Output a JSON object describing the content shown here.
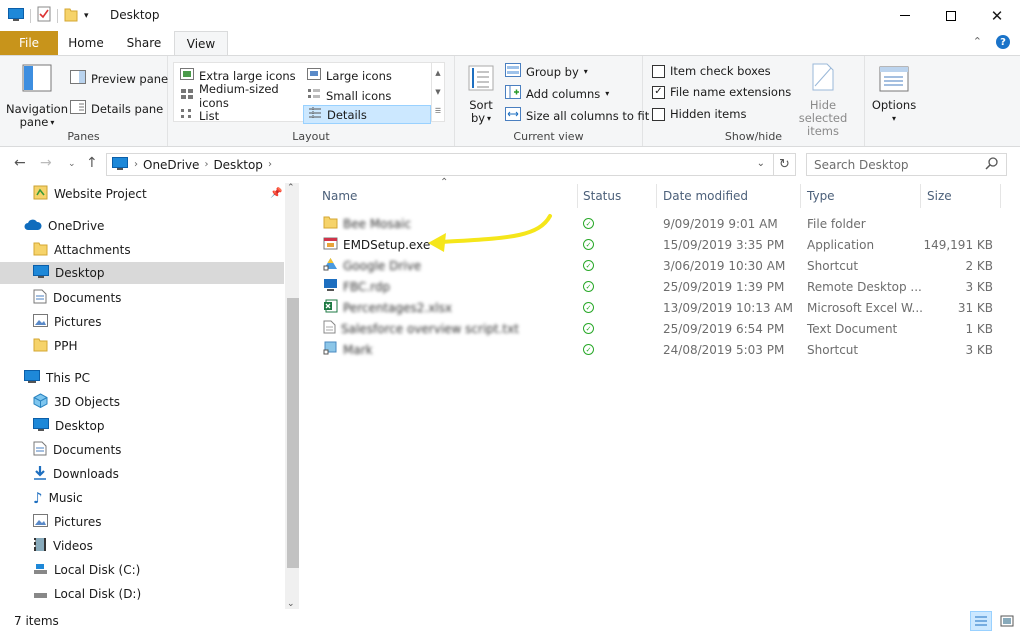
{
  "window": {
    "title": "Desktop"
  },
  "ribbon_tabs": {
    "file": "File",
    "home": "Home",
    "share": "Share",
    "view": "View"
  },
  "panes": {
    "navigation_pane": "Navigation",
    "navigation_pane_2": "pane",
    "preview_pane": "Preview pane",
    "details_pane": "Details pane",
    "label": "Panes"
  },
  "layout": {
    "extra_large_icons": "Extra large icons",
    "large_icons": "Large icons",
    "medium_icons": "Medium-sized icons",
    "small_icons": "Small icons",
    "list": "List",
    "details": "Details",
    "label": "Layout"
  },
  "current_view": {
    "sort_by": "Sort",
    "sort_by_2": "by",
    "group_by": "Group by",
    "add_columns": "Add columns",
    "size_all_columns": "Size all columns to fit",
    "label": "Current view"
  },
  "show_hide": {
    "item_check_boxes": "Item check boxes",
    "file_name_extensions": "File name extensions",
    "hidden_items": "Hidden items",
    "hide_selected": "Hide selected",
    "hide_selected_2": "items",
    "label": "Show/hide",
    "item_check_boxes_checked": false,
    "file_name_extensions_checked": true,
    "hidden_items_checked": false
  },
  "options": {
    "label": "Options"
  },
  "address": {
    "crumbs": [
      "OneDrive",
      "Desktop"
    ]
  },
  "search": {
    "placeholder": "Search Desktop"
  },
  "navpane": {
    "items": [
      {
        "label": "Website Project",
        "icon": "project-icon"
      },
      {
        "label": "OneDrive",
        "icon": "cloud-icon"
      },
      {
        "label": "Attachments",
        "icon": "folder-icon"
      },
      {
        "label": "Desktop",
        "icon": "desktop-icon"
      },
      {
        "label": "Documents",
        "icon": "documents-icon"
      },
      {
        "label": "Pictures",
        "icon": "pictures-icon"
      },
      {
        "label": "PPH",
        "icon": "folder-icon"
      },
      {
        "label": "This PC",
        "icon": "computer-icon"
      },
      {
        "label": "3D Objects",
        "icon": "cube-icon"
      },
      {
        "label": "Desktop",
        "icon": "desktop-icon"
      },
      {
        "label": "Documents",
        "icon": "documents-icon"
      },
      {
        "label": "Downloads",
        "icon": "download-icon"
      },
      {
        "label": "Music",
        "icon": "music-icon"
      },
      {
        "label": "Pictures",
        "icon": "pictures-icon"
      },
      {
        "label": "Videos",
        "icon": "video-icon"
      },
      {
        "label": "Local Disk (C:)",
        "icon": "drive-icon"
      },
      {
        "label": "Local Disk (D:)",
        "icon": "drive-icon"
      }
    ]
  },
  "columns": {
    "name": "Name",
    "status": "Status",
    "date": "Date modified",
    "type": "Type",
    "size": "Size"
  },
  "files": [
    {
      "name": "Bee Mosaic",
      "blurred": true,
      "date": "9/09/2019 9:01 AM",
      "type": "File folder",
      "size": ""
    },
    {
      "name": "EMDSetup.exe",
      "blurred": false,
      "date": "15/09/2019 3:35 PM",
      "type": "Application",
      "size": "149,191 KB"
    },
    {
      "name": "Google Drive",
      "blurred": true,
      "date": "3/06/2019 10:30 AM",
      "type": "Shortcut",
      "size": "2 KB"
    },
    {
      "name": "FBC.rdp",
      "blurred": true,
      "date": "25/09/2019 1:39 PM",
      "type": "Remote Desktop ...",
      "size": "3 KB"
    },
    {
      "name": "Percentages2.xlsx",
      "blurred": true,
      "date": "13/09/2019 10:13 AM",
      "type": "Microsoft Excel W...",
      "size": "31 KB"
    },
    {
      "name": "Salesforce overview script.txt",
      "blurred": true,
      "date": "25/09/2019 6:54 PM",
      "type": "Text Document",
      "size": "1 KB"
    },
    {
      "name": "Mark",
      "blurred": true,
      "date": "24/08/2019 5:03 PM",
      "type": "Shortcut",
      "size": "3 KB"
    }
  ],
  "status": {
    "items": "7 items"
  },
  "colors": {
    "file_tab": "#c8941b",
    "selected": "#cce8ff",
    "annotation_arrow": "#f5e61a",
    "sync_ok": "#2aa92a"
  }
}
